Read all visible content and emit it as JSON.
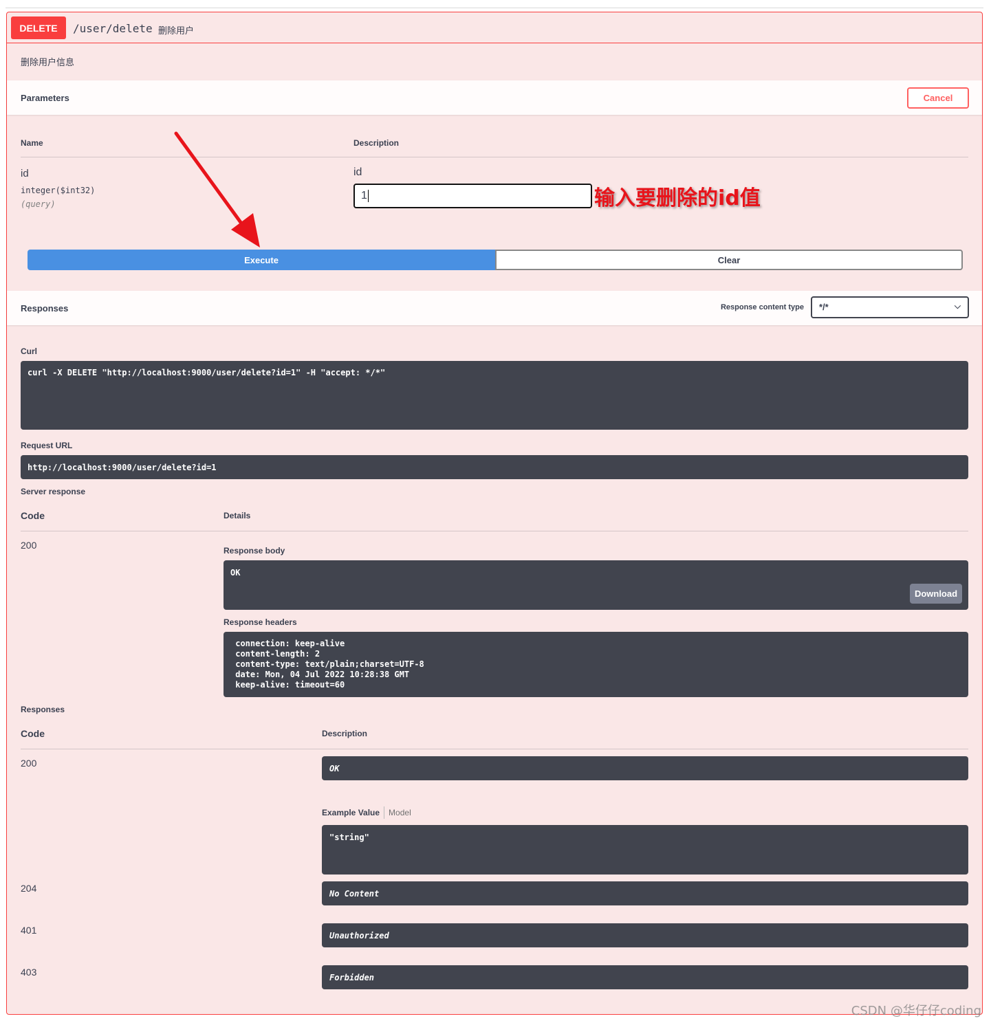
{
  "summary": {
    "method": "DELETE",
    "path": "/user/delete",
    "description": "删除用户"
  },
  "operation_description": "删除用户信息",
  "parameters": {
    "title": "Parameters",
    "cancel_label": "Cancel",
    "col_name": "Name",
    "col_description": "Description",
    "param": {
      "name": "id",
      "type": "integer($int32)",
      "in": "(query)",
      "label": "id",
      "value": "1"
    },
    "annotation": "输入要删除的id值",
    "execute_label": "Execute",
    "clear_label": "Clear"
  },
  "responses_header": {
    "title": "Responses",
    "content_type_label": "Response content type",
    "content_type_value": "*/*"
  },
  "curl": {
    "label": "Curl",
    "command": "curl -X DELETE \"http://localhost:9000/user/delete?id=1\" -H \"accept: */*\""
  },
  "request_url": {
    "label": "Request URL",
    "value": "http://localhost:9000/user/delete?id=1"
  },
  "server_response": {
    "label": "Server response",
    "col_code": "Code",
    "col_details": "Details",
    "code": "200",
    "body_label": "Response body",
    "body": "OK",
    "download_label": "Download",
    "headers_label": "Response headers",
    "headers": " connection: keep-alive \n content-length: 2 \n content-type: text/plain;charset=UTF-8 \n date: Mon, 04 Jul 2022 10:28:38 GMT \n keep-alive: timeout=60 "
  },
  "responses": {
    "label": "Responses",
    "col_code": "Code",
    "col_description": "Description",
    "items": [
      {
        "code": "200",
        "description": "OK"
      },
      {
        "code": "204",
        "description": "No Content"
      },
      {
        "code": "401",
        "description": "Unauthorized"
      },
      {
        "code": "403",
        "description": "Forbidden"
      }
    ],
    "example_tab": "Example Value",
    "model_tab": "Model",
    "example_value": "\"string\""
  },
  "watermark": "CSDN @华仔仔coding",
  "colors": {
    "delete": "#f93e3e",
    "block_bg": "#fae7e7",
    "execute": "#4990e2",
    "code_bg": "#41444e",
    "annotation": "#e8141b"
  },
  "icons": [
    "chevron-down-icon",
    "red-arrow-icon"
  ]
}
